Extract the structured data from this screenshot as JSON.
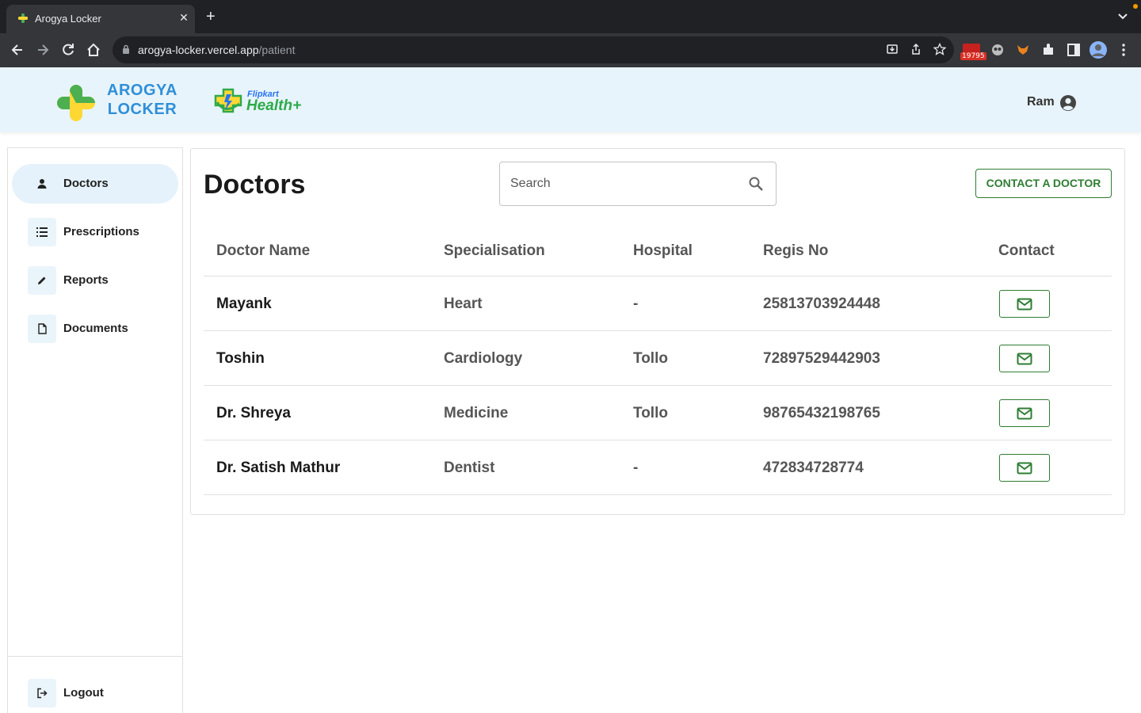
{
  "browser": {
    "tab_title": "Arogya Locker",
    "url_host": "arogya-locker.vercel.app",
    "url_path": "/patient",
    "extension_badge": "19795"
  },
  "header": {
    "brand_line1": "AROGYA",
    "brand_line2": "LOCKER",
    "partner_small": "Flipkart",
    "partner_large": "Health+",
    "user_name": "Ram"
  },
  "sidebar": {
    "items": [
      {
        "label": "Doctors",
        "icon": "doctor-icon",
        "active": true
      },
      {
        "label": "Prescriptions",
        "icon": "list-icon"
      },
      {
        "label": "Reports",
        "icon": "pencil-icon"
      },
      {
        "label": "Documents",
        "icon": "document-icon"
      }
    ],
    "logout_label": "Logout"
  },
  "main": {
    "title": "Doctors",
    "search_placeholder": "Search",
    "contact_button": "CONTACT A DOCTOR",
    "columns": [
      "Doctor Name",
      "Specialisation",
      "Hospital",
      "Regis No",
      "Contact"
    ],
    "rows": [
      {
        "name": "Mayank",
        "specialisation": "Heart",
        "hospital": "-",
        "regis_no": "25813703924448"
      },
      {
        "name": "Toshin",
        "specialisation": "Cardiology",
        "hospital": "Tollo",
        "regis_no": "72897529442903"
      },
      {
        "name": "Dr. Shreya",
        "specialisation": "Medicine",
        "hospital": "Tollo",
        "regis_no": "98765432198765"
      },
      {
        "name": "Dr. Satish Mathur",
        "specialisation": "Dentist",
        "hospital": "-",
        "regis_no": "472834728774"
      }
    ]
  },
  "colors": {
    "header_bg": "#e8f4fb",
    "accent_green": "#2e7d32",
    "brand_blue": "#2f8fd8",
    "active_nav_bg": "#e5f2fb"
  }
}
